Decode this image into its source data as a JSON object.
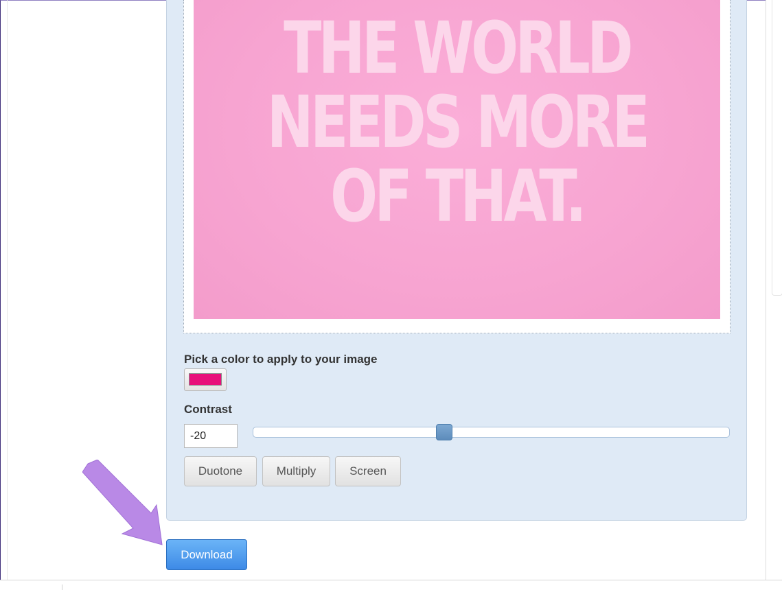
{
  "image_preview": {
    "quote_lines": [
      "THE WORLD",
      "NEEDS MORE",
      "OF THAT."
    ],
    "background_color": "#f7a4d1",
    "text_color": "#fcd6ea"
  },
  "color_picker": {
    "label": "Pick a color to apply to your image",
    "selected_color": "#e8107a"
  },
  "contrast": {
    "label": "Contrast",
    "value": "-20",
    "slider_position": 0.4
  },
  "modes": [
    {
      "label": "Duotone"
    },
    {
      "label": "Multiply"
    },
    {
      "label": "Screen"
    }
  ],
  "download": {
    "label": "Download",
    "color": "#4a9aee"
  },
  "annotation": {
    "arrow_color": "#b989e6"
  }
}
